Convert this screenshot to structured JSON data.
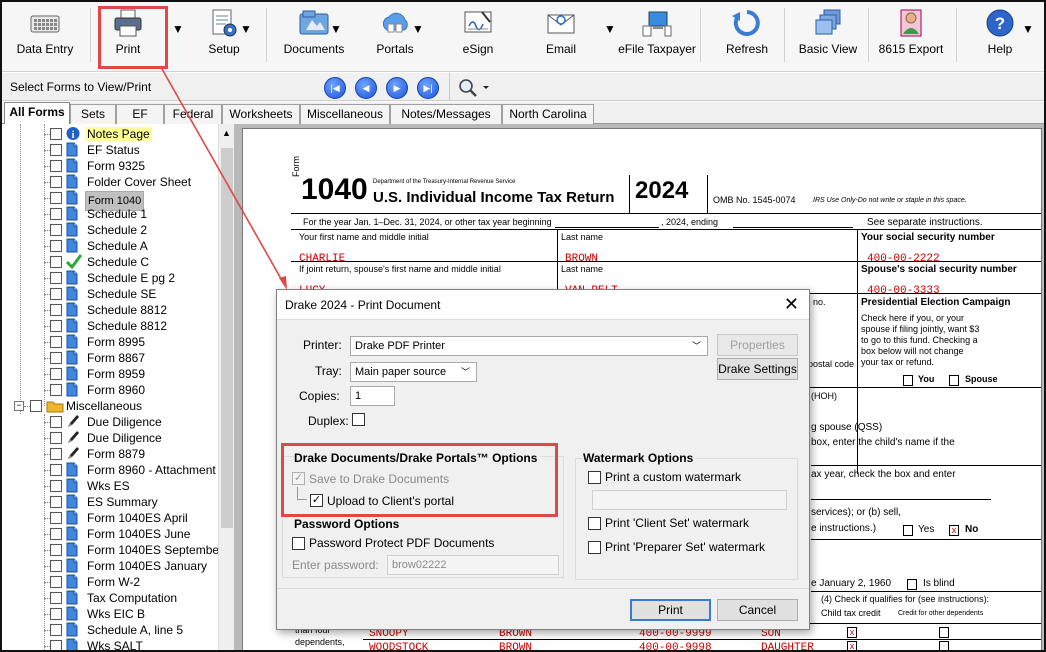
{
  "toolbar": {
    "items": [
      {
        "label": "Data Entry",
        "icon": "keyboard-icon"
      },
      {
        "label": "Print",
        "icon": "printer-icon"
      },
      {
        "label": "Setup",
        "icon": "setup-icon"
      },
      {
        "label": "Documents",
        "icon": "documents-icon"
      },
      {
        "label": "Portals",
        "icon": "cloud-portal-icon"
      },
      {
        "label": "eSign",
        "icon": "esign-icon"
      },
      {
        "label": "Email",
        "icon": "email-icon"
      },
      {
        "label": "eFile Taxpayer",
        "icon": "efile-icon"
      },
      {
        "label": "Refresh",
        "icon": "refresh-icon"
      },
      {
        "label": "Basic View",
        "icon": "basic-view-icon"
      },
      {
        "label": "8615 Export",
        "icon": "export-person-icon"
      },
      {
        "label": "Help",
        "icon": "help-icon"
      }
    ]
  },
  "nav": {
    "title": "Select Forms to View/Print"
  },
  "tabs": [
    "All Forms",
    "Sets",
    "EF",
    "Federal",
    "Worksheets",
    "Miscellaneous",
    "Notes/Messages",
    "North Carolina"
  ],
  "tree": {
    "items": [
      {
        "label": "Notes Page",
        "kind": "info"
      },
      {
        "label": "EF Status",
        "kind": "doc"
      },
      {
        "label": "Form 9325",
        "kind": "doc"
      },
      {
        "label": "Folder Cover Sheet",
        "kind": "doc"
      },
      {
        "label": "Form 1040",
        "kind": "doc"
      },
      {
        "label": "Schedule 1",
        "kind": "doc"
      },
      {
        "label": "Schedule 2",
        "kind": "doc"
      },
      {
        "label": "Schedule A",
        "kind": "doc"
      },
      {
        "label": "Schedule C",
        "kind": "check"
      },
      {
        "label": "Schedule E pg 2",
        "kind": "doc"
      },
      {
        "label": "Schedule SE",
        "kind": "doc"
      },
      {
        "label": "Schedule 8812",
        "kind": "doc"
      },
      {
        "label": "Schedule 8812",
        "kind": "doc"
      },
      {
        "label": "Form 8995",
        "kind": "doc"
      },
      {
        "label": "Form 8867",
        "kind": "doc"
      },
      {
        "label": "Form 8959",
        "kind": "doc"
      },
      {
        "label": "Form 8960",
        "kind": "doc"
      },
      {
        "label": "Miscellaneous",
        "kind": "folder"
      },
      {
        "label": "Due Diligence",
        "kind": "pen"
      },
      {
        "label": "Due Diligence",
        "kind": "pen"
      },
      {
        "label": "Form 8879",
        "kind": "pen"
      },
      {
        "label": "Form 8960 - Attachment",
        "kind": "doc"
      },
      {
        "label": "Wks ES",
        "kind": "doc"
      },
      {
        "label": "ES Summary",
        "kind": "doc"
      },
      {
        "label": "Form 1040ES April",
        "kind": "doc"
      },
      {
        "label": "Form 1040ES June",
        "kind": "doc"
      },
      {
        "label": "Form 1040ES September",
        "kind": "doc"
      },
      {
        "label": "Form 1040ES January",
        "kind": "doc"
      },
      {
        "label": "Form W-2",
        "kind": "doc"
      },
      {
        "label": "Tax Computation",
        "kind": "doc"
      },
      {
        "label": "Wks EIC B",
        "kind": "doc"
      },
      {
        "label": "Schedule A, line 5",
        "kind": "doc"
      },
      {
        "label": "Wks SALT",
        "kind": "doc"
      }
    ]
  },
  "form": {
    "form_word": "Form",
    "number": "1040",
    "dept": "Department of the Treasury-Internal Revenue Service",
    "title": "U.S. Individual Income Tax Return",
    "year": "2024",
    "omb": "OMB No. 1545-0074",
    "irs_use": "IRS Use Only-Do not write or staple in this space.",
    "year_line": "For the year Jan. 1–Dec. 31, 2024, or other tax year beginning",
    "year_ending": ", 2024, ending",
    "see_instr": "See separate instructions.",
    "first_name_label": "Your first name and middle initial",
    "last_name_label": "Last name",
    "ssn_label": "Your social security number",
    "first_name": "CHARLIE",
    "last_name": "BROWN",
    "ssn": "400-00-2222",
    "spouse_label": "If joint return, spouse's first name and middle initial",
    "spouse_last_label": "Last name",
    "spouse_ssn_label": "Spouse's social security number",
    "spouse_first": "LUCY",
    "spouse_last": "VAN PELT",
    "spouse_ssn": "400-00-3333",
    "apt_label": "no.",
    "pec_title": "Presidential Election Campaign",
    "pec_text1": "Check here if you, or your",
    "pec_text2": "spouse if filing jointly, want $3",
    "pec_text3": "to go to this fund. Checking a",
    "pec_text4": "box below will not change",
    "pec_text5": "your tax or refund.",
    "you": "You",
    "spouse": "Spouse",
    "postal": "postal code",
    "hoh": "(HOH)",
    "qss": "g spouse (QSS)",
    "child_box": "box, enter the child's name if the",
    "tax_year": "ax year, check the box and enter",
    "services": "services); or (b) sell,",
    "yes": "Yes",
    "no": "No",
    "instructions": "e instructions.)",
    "january": "e January 2, 1960",
    "is_blind": "Is blind",
    "qualifies": "(4) Check if qualifies for (see instructions):",
    "ctc": "Child tax credit",
    "cod": "Credit for other dependents",
    "dependents_label1": "than four",
    "dependents_label2": "dependents,",
    "dependents": [
      {
        "first": "SNOOPY",
        "last": "BROWN",
        "ssn": "400-00-9999",
        "rel": "SON"
      },
      {
        "first": "WOODSTOCK",
        "last": "BROWN",
        "ssn": "400-00-9998",
        "rel": "DAUGHTER"
      }
    ]
  },
  "dialog": {
    "title": "Drake 2024 - Print Document",
    "printer_label": "Printer:",
    "printer_value": "Drake PDF Printer",
    "properties": "Properties",
    "tray_label": "Tray:",
    "tray_value": "Main paper source",
    "drake_settings": "Drake Settings",
    "copies_label": "Copies:",
    "copies_value": "1",
    "duplex_label": "Duplex:",
    "portals_group": "Drake Documents/Drake Portals™ Options",
    "save_to_dd": "Save to Drake Documents",
    "upload_portal": "Upload to Client's portal",
    "password_group": "Password Options",
    "password_protect": "Password Protect PDF Documents",
    "enter_password": "Enter password:",
    "password_value": "brow02222",
    "watermark_group": "Watermark Options",
    "custom_watermark": "Print a custom watermark",
    "client_set": "Print 'Client Set' watermark",
    "preparer_set": "Print 'Preparer Set' watermark",
    "print_btn": "Print",
    "cancel_btn": "Cancel",
    "save_checked": true,
    "upload_checked": true
  },
  "colors": {
    "highlight": "#e04848",
    "filled": "#cc0000",
    "nav_blue": "#1d55d6"
  }
}
